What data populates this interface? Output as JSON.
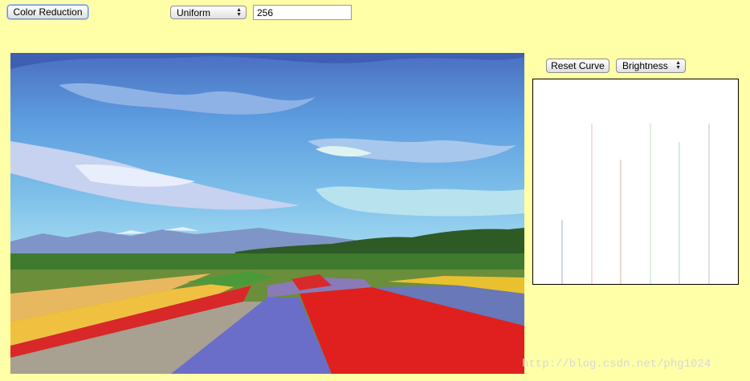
{
  "toolbar": {
    "color_reduction_label": "Color Reduction",
    "mode_selected": "Uniform",
    "colors_value": "256"
  },
  "curve_panel": {
    "reset_label": "Reset Curve",
    "channel_selected": "Brightness"
  },
  "watermark": "http://blog.csdn.net/phg1024",
  "colors": {
    "page_background": "#ffffa8",
    "button_focus": "#6d94c8"
  }
}
